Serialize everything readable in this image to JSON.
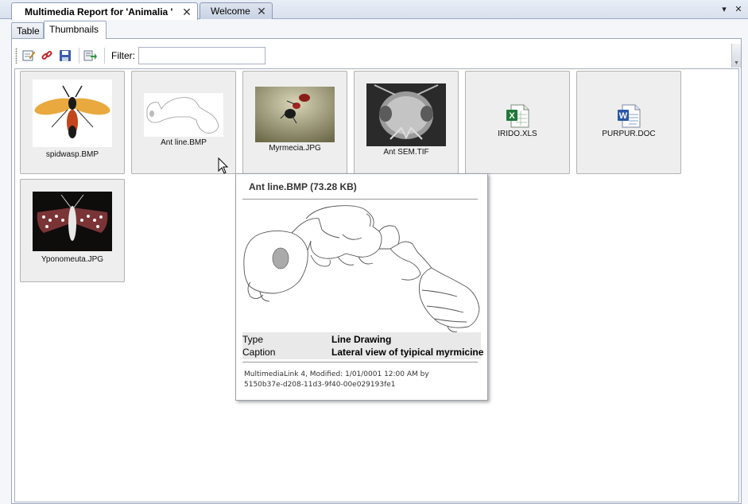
{
  "doc_tabs": [
    {
      "label": "Multimedia Report for 'Animalia '",
      "active": true
    },
    {
      "label": "Welcome",
      "active": false
    }
  ],
  "view_tabs": [
    "Table",
    "Thumbnails"
  ],
  "toolbar": {
    "buttons": [
      "edit-icon",
      "link-icon",
      "save-icon",
      "export-icon"
    ],
    "filter_label": "Filter:",
    "filter_value": ""
  },
  "thumbnails": [
    {
      "caption": "spidwasp.BMP"
    },
    {
      "caption": "Ant line.BMP"
    },
    {
      "caption": "Myrmecia.JPG"
    },
    {
      "caption": "Ant SEM.TIF"
    },
    {
      "caption": "IRIDO.XLS"
    },
    {
      "caption": "PURPUR.DOC"
    },
    {
      "caption": "Yponomeuta.JPG"
    }
  ],
  "tooltip": {
    "title": "Ant line.BMP (73.28 KB)",
    "type_label": "Type",
    "type_value": "Line Drawing",
    "caption_label": "Caption",
    "caption_value": "Lateral view of tyipical myrmicine",
    "footer_line1": "MultimediaLink 4, Modified: 1/01/0001 12:00 AM by",
    "footer_line2": "5150b37e-d208-11d3-9f40-00e029193fe1"
  },
  "colors": {
    "tab_border": "#8d9bb4",
    "thumb_bg": "#eeeeee",
    "excel_green": "#1f7a3a",
    "word_blue": "#2a57a8"
  }
}
